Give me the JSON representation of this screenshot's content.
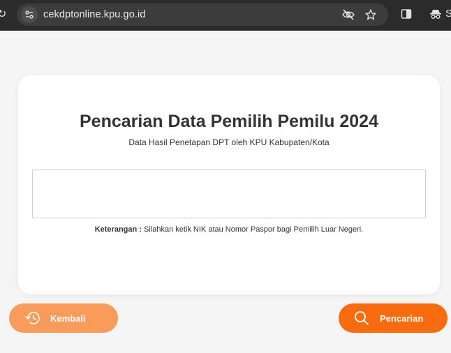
{
  "browser": {
    "url": "cekdptonline.kpu.go.id",
    "profile_initial": "S",
    "icons": [
      "reload-icon",
      "site-info-icon",
      "eye-off-icon",
      "star-icon",
      "side-panel-icon",
      "incognito-icon"
    ]
  },
  "page": {
    "title": "Pencarian Data Pemilih Pemilu 2024",
    "subtitle": "Data Hasil Penetapan DPT oleh KPU Kabupaten/Kota",
    "search_value": "",
    "note_label": "Keterangan :",
    "note_text": " Silahkan ketik NIK atau Nomor Paspor bagi Pemilih Luar Negeri."
  },
  "buttons": {
    "back_label": "Kembali",
    "search_label": "Pencarian"
  },
  "colors": {
    "back_button": "#f99b5b",
    "search_button": "#f96b0f",
    "toolbar": "#2b2b2b"
  }
}
